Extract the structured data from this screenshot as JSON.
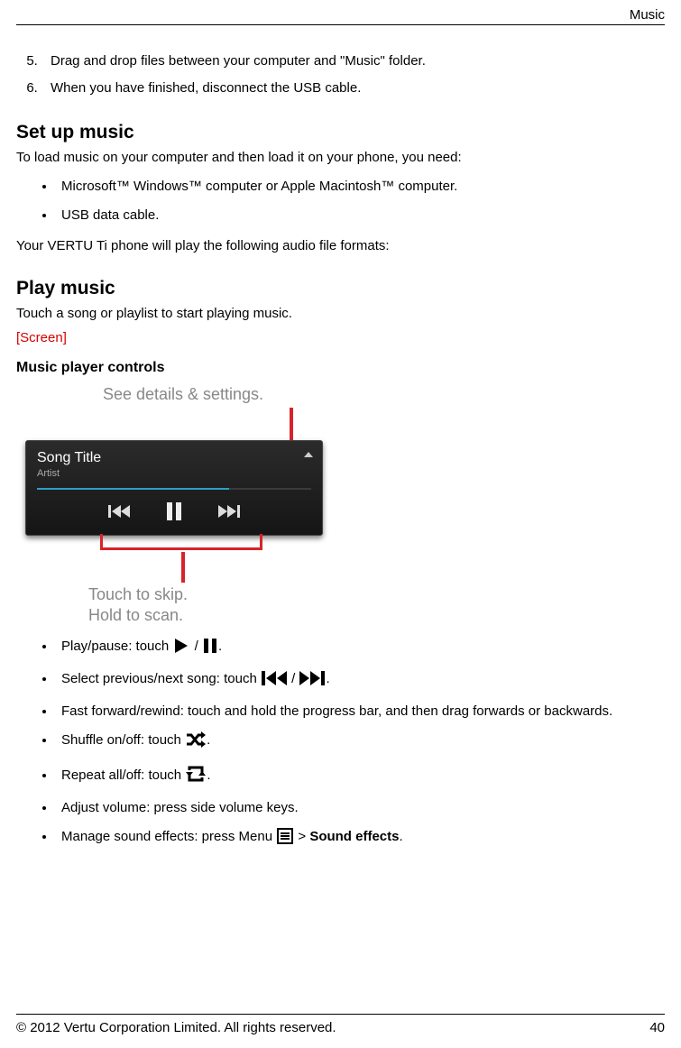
{
  "header": {
    "section_label": "Music"
  },
  "steps": {
    "start": 5,
    "items": [
      "Drag and drop files between your computer and \"Music\" folder.",
      "When you have finished, disconnect the USB cable."
    ]
  },
  "setup": {
    "heading": "Set up music",
    "intro": "To load music on your computer and then load it on your phone, you need:",
    "bullets": [
      "Microsoft™ Windows™ computer or Apple Macintosh™ computer.",
      "USB data cable."
    ],
    "outro": "Your VERTU Ti phone will play the following audio file formats:"
  },
  "play": {
    "heading": "Play music",
    "intro": "Touch a song or playlist to start playing music.",
    "placeholder": "[Screen]",
    "subhead": "Music player controls"
  },
  "figure": {
    "caption_top": "See details & settings.",
    "song_title": "Song Title",
    "artist": "Artist",
    "caption_bottom_line1": "Touch to skip.",
    "caption_bottom_line2": "Hold to scan."
  },
  "controls": {
    "play_pause_pre": "Play/pause: touch ",
    "play_pause_sep": " / ",
    "prev_next_pre": "Select previous/next song: touch ",
    "prev_next_sep": " / ",
    "seek": "Fast forward/rewind: touch and hold the progress bar, and then drag forwards or backwards.",
    "shuffle_pre": "Shuffle on/off: touch ",
    "repeat_pre": "Repeat all/off: touch ",
    "volume": "Adjust volume: press side volume keys.",
    "effects_pre": "Manage sound effects: press Menu ",
    "effects_gt": " > ",
    "effects_bold": "Sound effects",
    "period": "."
  },
  "footer": {
    "copyright": "© 2012 Vertu Corporation Limited. All rights reserved.",
    "page": "40"
  }
}
